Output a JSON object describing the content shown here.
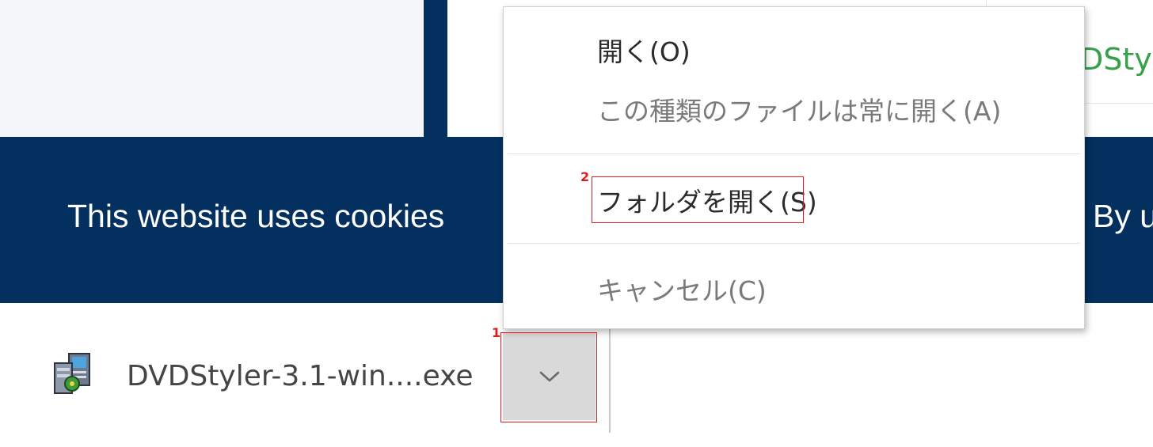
{
  "background": {
    "partial_link_text": "DSty",
    "cookie_banner": {
      "left_text": "This website uses cookies",
      "right_text": "By u"
    }
  },
  "download_bar": {
    "file_name": "DVDStyler-3.1-win....exe",
    "file_icon": "installer-icon",
    "dropdown_icon": "chevron-down-icon"
  },
  "context_menu": {
    "items": [
      {
        "label": "開く(O)",
        "enabled": true
      },
      {
        "label": "この種類のファイルは常に開く(A)",
        "enabled": false
      },
      {
        "label": "フォルダを開く(S)",
        "enabled": true
      },
      {
        "label": "キャンセル(C)",
        "enabled": false
      }
    ]
  },
  "annotations": {
    "step1": "1",
    "step2": "2",
    "highlight_color": "#e5191b"
  },
  "colors": {
    "navy": "#04305f",
    "link_green": "#35a24a",
    "dropdown_bg": "#d9d9d9"
  }
}
